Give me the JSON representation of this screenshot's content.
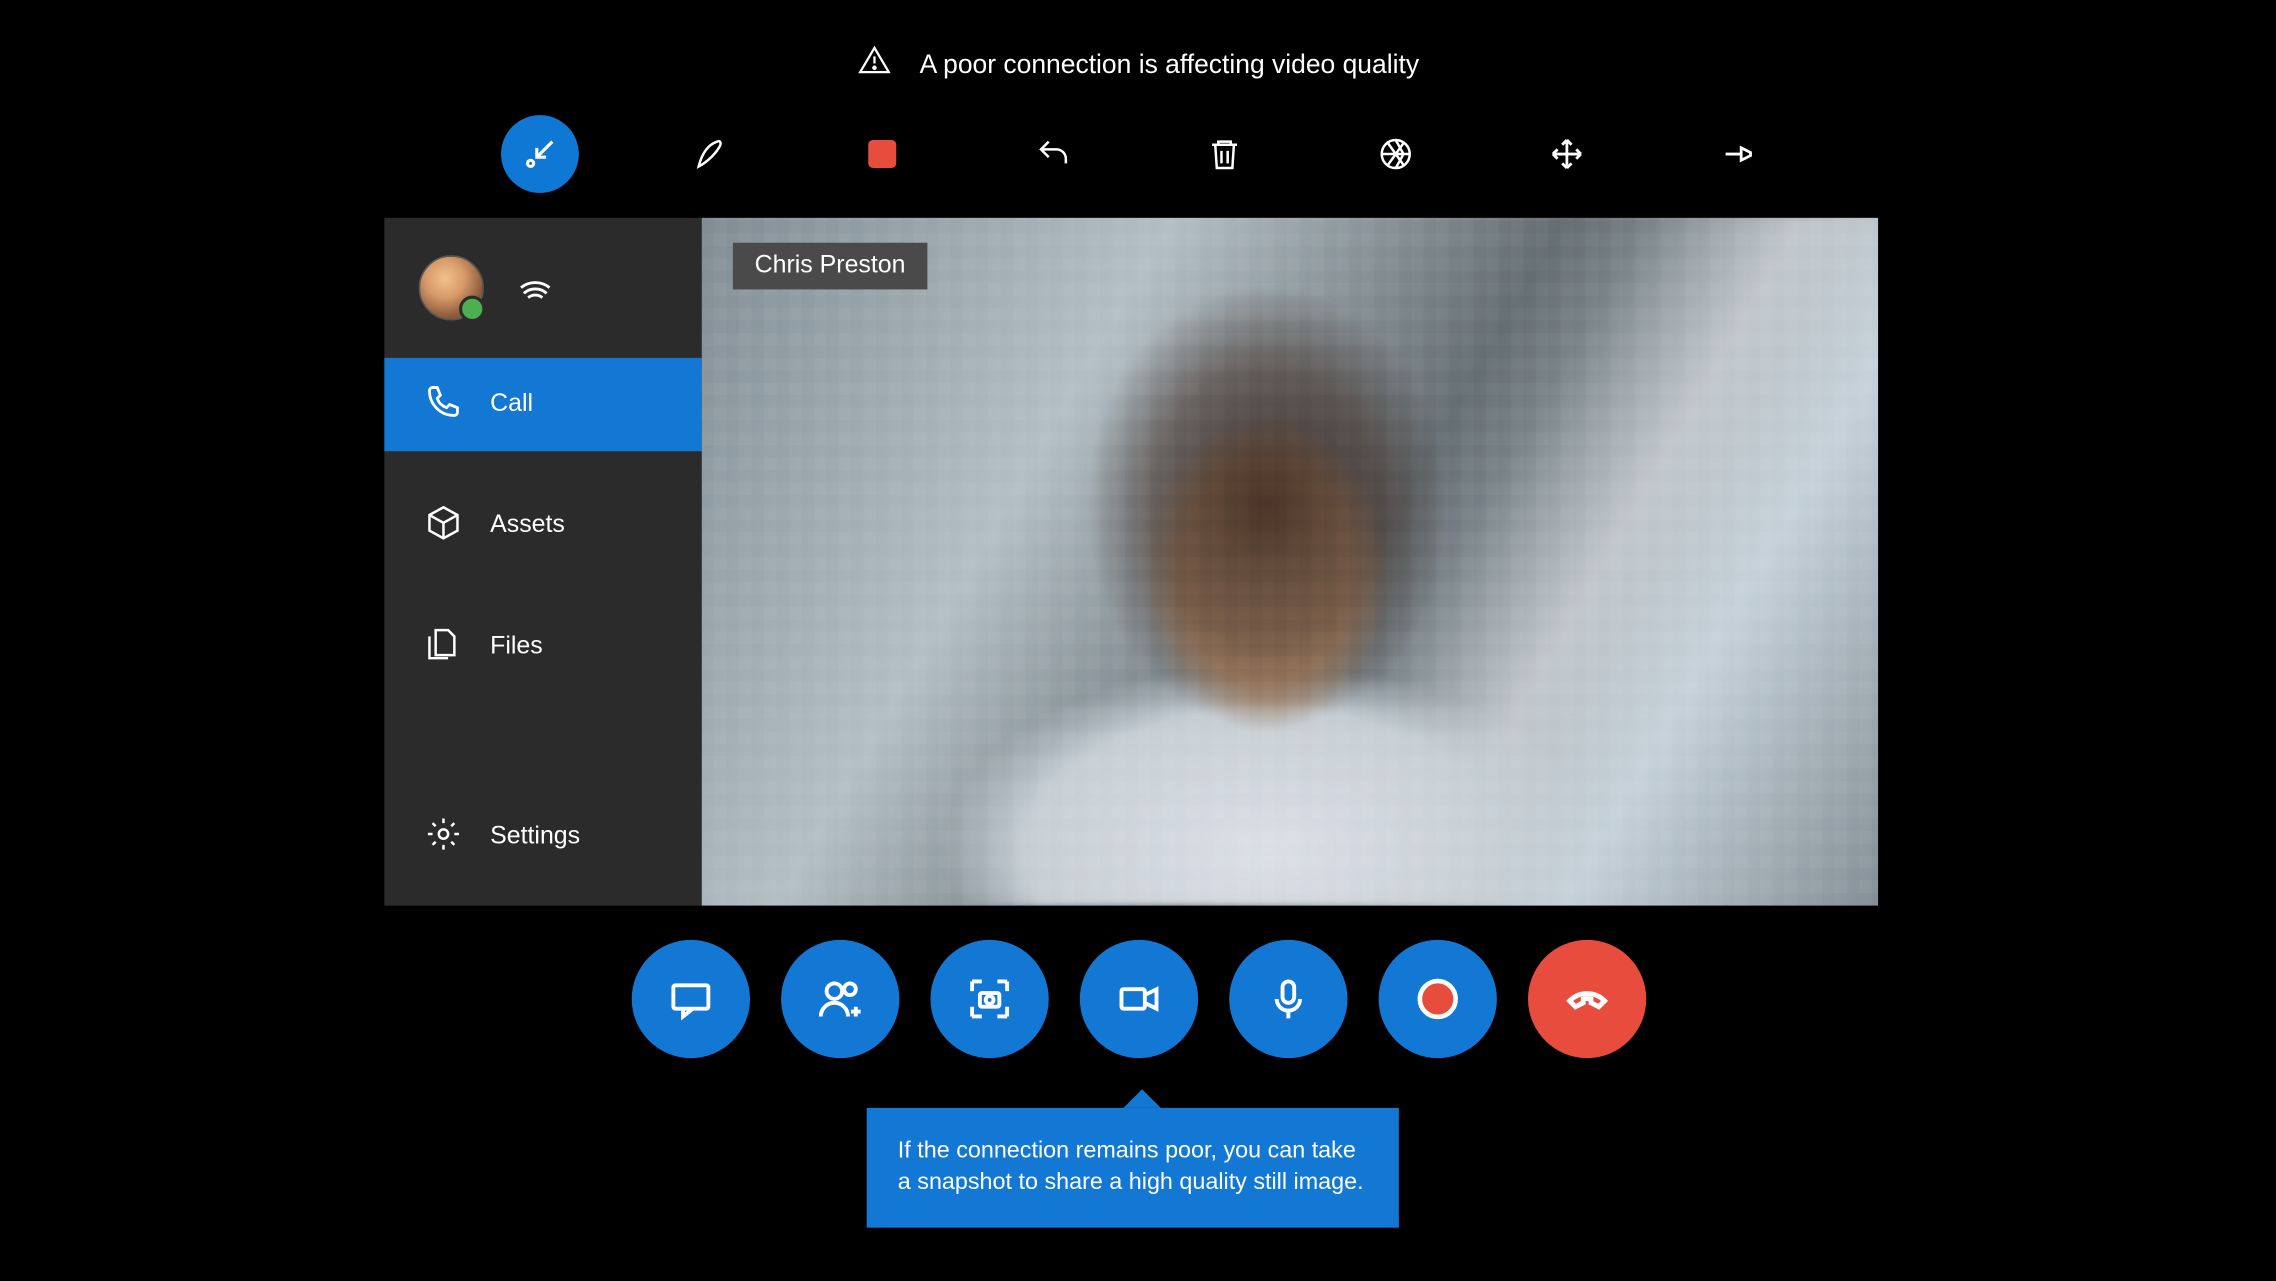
{
  "warning": {
    "text": "A poor connection is affecting video quality"
  },
  "toolbar": {
    "collapse_icon": "collapse-arrow-icon",
    "draw_icon": "pen-icon",
    "stop_icon": "stop-square-icon",
    "undo_icon": "undo-icon",
    "delete_icon": "trash-icon",
    "aperture_icon": "aperture-icon",
    "expand_icon": "expand-arrows-icon",
    "pin_icon": "pin-icon"
  },
  "sidebar": {
    "items": [
      {
        "label": "Call",
        "icon": "phone-icon",
        "active": true
      },
      {
        "label": "Assets",
        "icon": "cube-icon",
        "active": false
      },
      {
        "label": "Files",
        "icon": "files-icon",
        "active": false
      },
      {
        "label": "Settings",
        "icon": "gear-icon",
        "active": false
      }
    ]
  },
  "video": {
    "participant_name": "Chris Preston"
  },
  "call_buttons": {
    "chat": "chat-icon",
    "add_people": "add-people-icon",
    "snapshot": "snapshot-icon",
    "video": "video-icon",
    "mic": "microphone-icon",
    "record": "record-icon",
    "hangup": "hang-up-icon"
  },
  "tooltip": {
    "text": "If the connection remains poor, you can take a snapshot to share a high quality still image."
  },
  "colors": {
    "accent": "#1278d4",
    "danger": "#e74c3c"
  }
}
